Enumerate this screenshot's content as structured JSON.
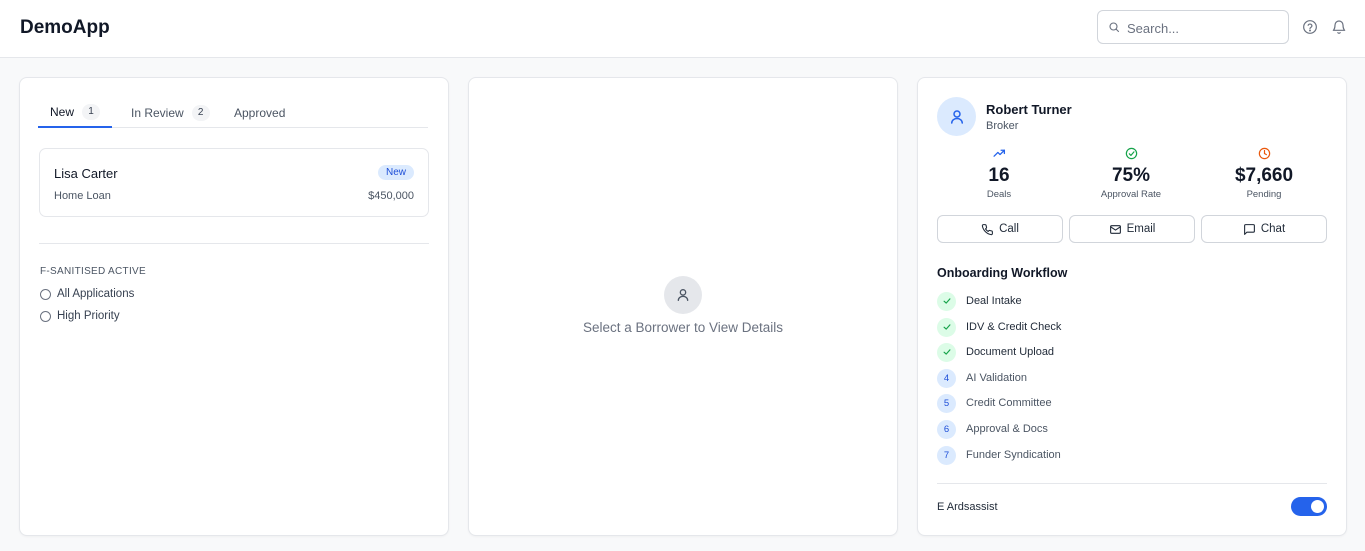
{
  "app": {
    "title": "DemoApp"
  },
  "search": {
    "placeholder": "Search..."
  },
  "header_icons": [
    "help-circle-icon",
    "bell-icon"
  ],
  "left_panel": {
    "tabs": [
      {
        "label": "New",
        "count": "1",
        "active": true
      },
      {
        "label": "In Review",
        "count": "2",
        "active": false
      },
      {
        "label": "Approved",
        "count": null,
        "active": false
      }
    ],
    "borrowers": [
      {
        "name": "Lisa Carter",
        "badge": "New",
        "loan_type": "Home Loan",
        "amount": "$450,000"
      }
    ],
    "filter": {
      "title": "F-SANITISED ACTIVE",
      "options": [
        "All Applications",
        "High Priority"
      ]
    }
  },
  "middle_panel": {
    "empty_state_text": "Select a Borrower to View Details"
  },
  "right_panel": {
    "profile": {
      "name": "Robert Turner",
      "role": "Broker"
    },
    "stats": [
      {
        "value": "16",
        "label": "Deals",
        "icon": "trending-up-icon",
        "color": "#2563eb"
      },
      {
        "value": "75%",
        "label": "Approval Rate",
        "icon": "check-circle-icon",
        "color": "#16a34a"
      },
      {
        "value": "$7,660",
        "label": "Pending",
        "icon": "clock-icon",
        "color": "#ea580c"
      }
    ],
    "actions": [
      {
        "label": "Call",
        "icon": "phone-icon"
      },
      {
        "label": "Email",
        "icon": "mail-icon"
      },
      {
        "label": "Chat",
        "icon": "message-square-icon"
      }
    ],
    "workflow": {
      "title": "Onboarding Workflow",
      "steps": [
        {
          "label": "Deal Intake",
          "status": "done"
        },
        {
          "label": "IDV & Credit Check",
          "status": "done"
        },
        {
          "label": "Document Upload",
          "status": "done"
        },
        {
          "label": "AI Validation",
          "status": "pending",
          "number": "4"
        },
        {
          "label": "Credit Committee",
          "status": "pending",
          "number": "5"
        },
        {
          "label": "Approval & Docs",
          "status": "pending",
          "number": "6"
        },
        {
          "label": "Funder Syndication",
          "status": "pending",
          "number": "7"
        }
      ]
    },
    "assist": {
      "label": "E Ardsassist",
      "enabled": true
    }
  },
  "colors": {
    "accent": "#2563eb",
    "success": "#16a34a",
    "warning": "#ea580c",
    "badge_bg": "#dbeafe"
  }
}
